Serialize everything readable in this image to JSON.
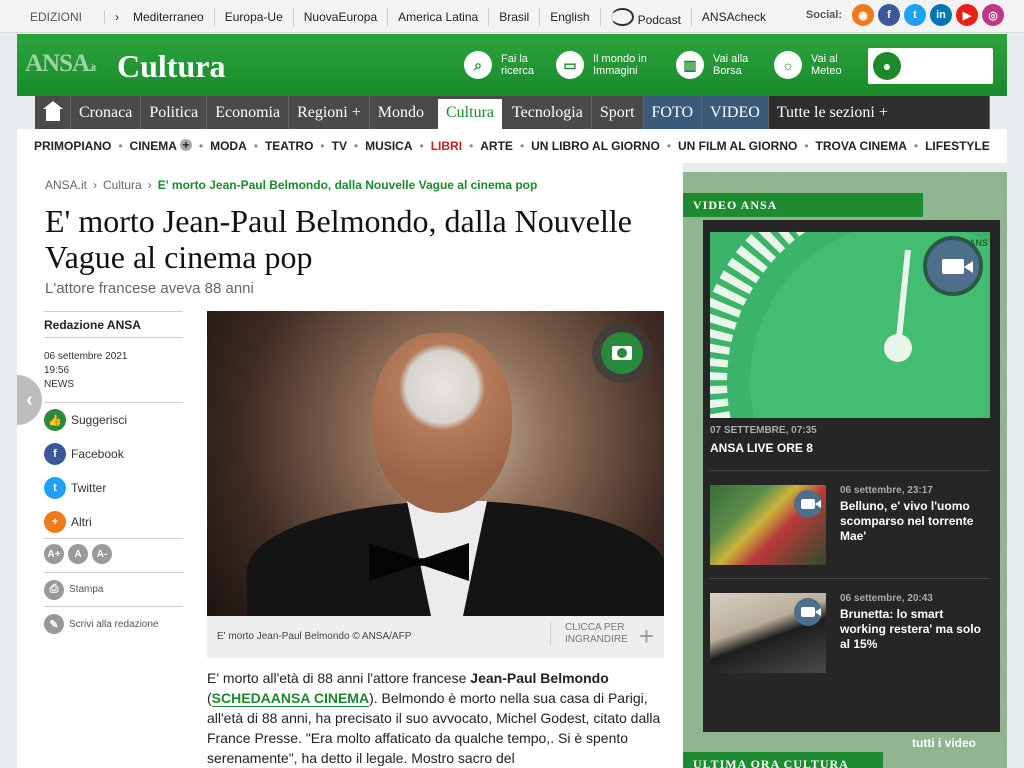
{
  "topbar": {
    "editions_label": "EDIZIONI",
    "editions": [
      "Mediterraneo",
      "Europa-Ue",
      "NuovaEuropa",
      "America Latina",
      "Brasil",
      "English",
      "Podcast",
      "ANSAcheck"
    ],
    "social_label": "Social:"
  },
  "header": {
    "logo": "ANSA",
    "logo_suffix": ".it",
    "section": "Cultura",
    "buttons": [
      {
        "line1": "Fai la",
        "line2": "ricerca",
        "icon": "search-icon"
      },
      {
        "line1": "Il mondo in",
        "line2": "Immagini",
        "icon": "monitor-icon"
      },
      {
        "line1": "Vai alla",
        "line2": "Borsa",
        "icon": "chart-icon"
      },
      {
        "line1": "Vai al",
        "line2": "Meteo",
        "icon": "weather-icon"
      }
    ]
  },
  "nav": {
    "items": [
      "Cronaca",
      "Politica",
      "Economia",
      "Regioni +",
      "Mondo",
      "Cultura",
      "Tecnologia",
      "Sport",
      "FOTO",
      "VIDEO",
      "Tutte le sezioni +"
    ]
  },
  "subnav": {
    "items": [
      "PRIMOPIANO",
      "CINEMA",
      "MODA",
      "TEATRO",
      "TV",
      "MUSICA",
      "LIBRI",
      "ARTE",
      "UN LIBRO AL GIORNO",
      "UN FILM AL GIORNO",
      "TROVA CINEMA",
      "LIFESTYLE"
    ]
  },
  "breadcrumb": {
    "home": "ANSA.it",
    "section": "Cultura",
    "current": "E' morto Jean-Paul Belmondo, dalla Nouvelle Vague al cinema pop"
  },
  "article": {
    "title": "E' morto Jean-Paul Belmondo, dalla Nouvelle Vague al cinema pop",
    "subtitle": "L'attore francese aveva 88 anni",
    "author": "Redazione ANSA",
    "date": "06 settembre 2021",
    "time": "19:56",
    "category": "NEWS",
    "tools": [
      "Suggerisci",
      "Facebook",
      "Twitter",
      "Altri"
    ],
    "font_sizes": [
      "A+",
      "A",
      "A-"
    ],
    "print": "Stampa",
    "write": "Scrivi alla redazione",
    "photo_caption": "E' morto Jean-Paul Belmondo © ANSA/AFP",
    "enlarge": "CLICCA PER INGRANDIRE",
    "body_p1": "E' morto all'età di 88 anni l'attore francese ",
    "body_name": "Jean-Paul Belmondo",
    "body_p2": " (",
    "body_link": "SCHEDAANSA CINEMA",
    "body_p3": "). Belmondo è morto nella sua casa di Parigi, all'età di 88 anni, ha precisato il suo avvocato, Michel Godest, citato dalla France Presse. \"Era molto affaticato da qualche tempo,. Si è spento serenamente\", ha detto il legale. Mostro sacro del"
  },
  "sidebar": {
    "video_title": "VIDEO ANSA",
    "main_video": {
      "date": "07 SETTEMBRE, 07:35",
      "title": "ANSA LIVE ORE 8",
      "tag": "ANS"
    },
    "videos": [
      {
        "date": "06 settembre, 23:17",
        "title": "Belluno, e' vivo l'uomo scomparso nel torrente Mae'"
      },
      {
        "date": "06 settembre, 20:43",
        "title": "Brunetta: lo smart working restera' ma solo al 15%"
      }
    ],
    "all_videos": "tutti i video",
    "latest_title": "ULTIMA ORA CULTURA"
  },
  "colors": {
    "brand_green": "#1a8a2b",
    "nav_dark": "#4a4a4a",
    "foto_video": "#3b5a7a"
  }
}
